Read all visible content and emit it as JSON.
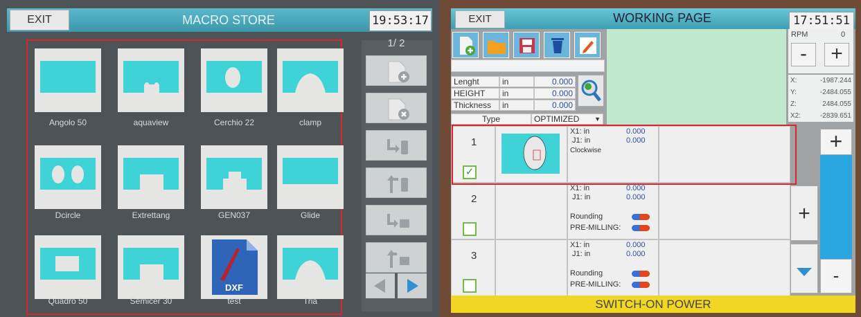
{
  "macro_store": {
    "exit_label": "EXIT",
    "title": "MACRO STORE",
    "time": "19:53:17",
    "page_indicator": "1/ 2",
    "macros": [
      {
        "label": "Angolo 50",
        "shape": "rect"
      },
      {
        "label": "aquaview",
        "shape": "notch"
      },
      {
        "label": "Cerchio 22",
        "shape": "circle"
      },
      {
        "label": "clamp",
        "shape": "arch"
      },
      {
        "label": "Dcircle",
        "shape": "two-circles"
      },
      {
        "label": "Extrettang",
        "shape": "bridge"
      },
      {
        "label": "GEN037",
        "shape": "bridge-notch"
      },
      {
        "label": "Glide",
        "shape": "rect-bottom"
      },
      {
        "label": "Quadro 50",
        "shape": "window"
      },
      {
        "label": "Semicer 30",
        "shape": "bridge"
      },
      {
        "label": "test",
        "shape": "dxf-file",
        "file_tag": "DXF"
      },
      {
        "label": "Tria",
        "shape": "arch"
      }
    ],
    "side_buttons": [
      "add-file-icon",
      "delete-file-icon",
      "usb-import-icon",
      "usb-export-icon",
      "drive-import-icon",
      "drive-export-icon"
    ],
    "nav": [
      "arrow-left-icon",
      "arrow-right-icon"
    ]
  },
  "working_page": {
    "exit_label": "EXIT",
    "title": "WORKING PAGE",
    "time": "17:51:51",
    "toolbar": [
      "new-file-icon",
      "open-folder-icon",
      "save-icon",
      "trash-icon",
      "edit-icon"
    ],
    "fields": [
      {
        "label": "Lenght",
        "unit": "in",
        "value": "0.000"
      },
      {
        "label": "HEIGHT",
        "unit": "in",
        "value": "0.000"
      },
      {
        "label": "Thickness",
        "unit": "in",
        "value": "0.000"
      }
    ],
    "type_label": "Type",
    "type_value": "OPTIMIZED",
    "rpm_label": "RPM",
    "rpm_value": "0",
    "rpm_minus": "-",
    "rpm_plus": "+",
    "coords": [
      {
        "axis": "X:",
        "value": "-1987.244"
      },
      {
        "axis": "Y:",
        "value": "-2484.055"
      },
      {
        "axis": "Z:",
        "value": "2484.055"
      },
      {
        "axis": "X2:",
        "value": "-2839.651"
      }
    ],
    "rows": [
      {
        "num": "1",
        "checked": true,
        "x1_label": "X1: in",
        "x1_value": "0.000",
        "j1_label": "J1: in",
        "j1_value": "0.000",
        "direction": "Clockwise"
      },
      {
        "num": "2",
        "checked": false,
        "x1_label": "X1: in",
        "x1_value": "0.000",
        "j1_label": "J1: in",
        "j1_value": "0.000",
        "rounding": "Rounding",
        "premilling": "PRE-MILLING:"
      },
      {
        "num": "3",
        "checked": false,
        "x1_label": "X1: in",
        "x1_value": "0.000",
        "j1_label": "J1: in",
        "j1_value": "0.000",
        "rounding": "Rounding",
        "premilling": "PRE-MILLING:"
      }
    ],
    "right_plus": "+",
    "mid_plus": "+",
    "minus": "-",
    "status": "SWITCH-ON POWER",
    "check_mark": "✓"
  }
}
